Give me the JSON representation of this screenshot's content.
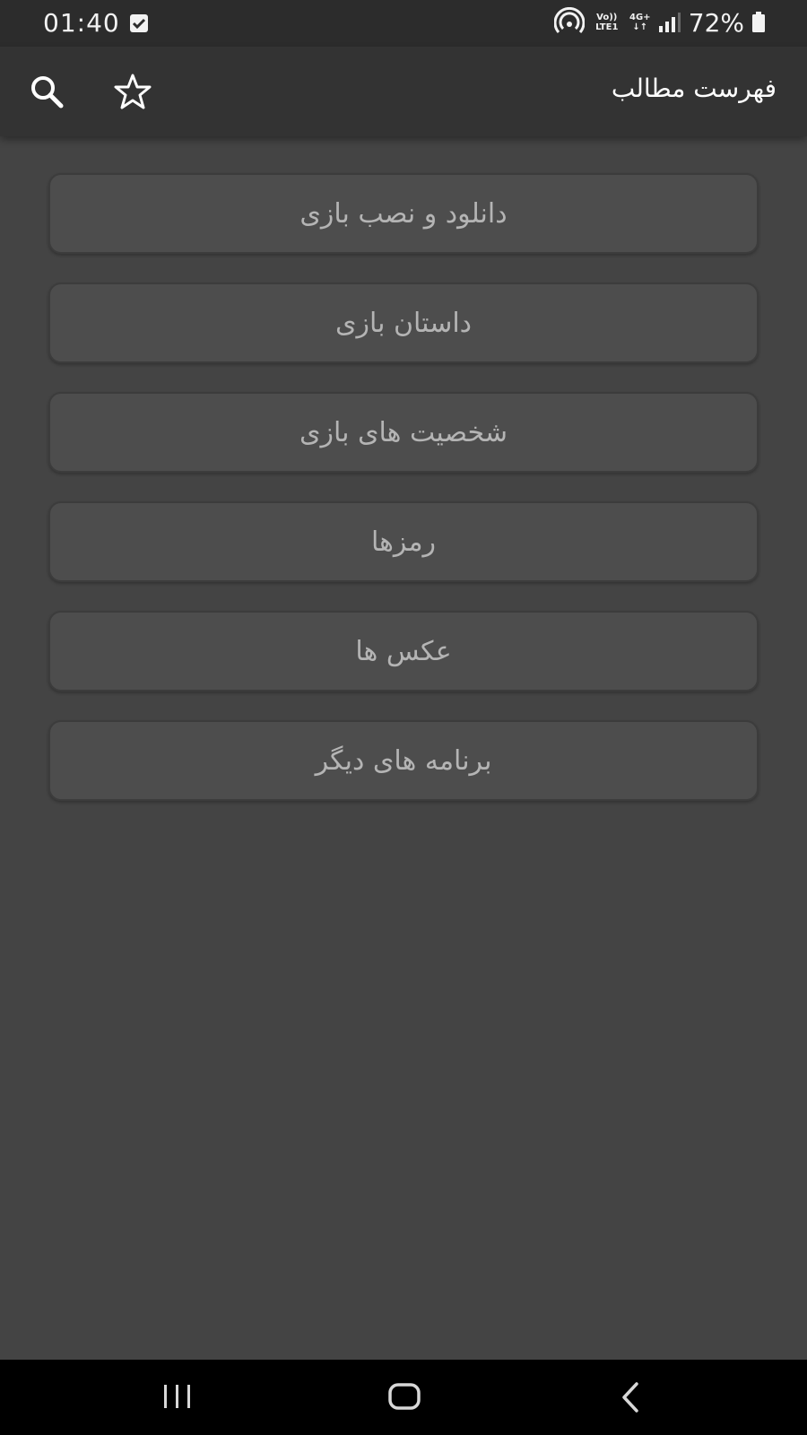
{
  "status_bar": {
    "time": "01:40",
    "volte_top": "Vo))",
    "volte_bottom": "LTE1",
    "network_top": "4G+",
    "network_bottom": "↓↑",
    "battery": "72%",
    "icons": [
      "check-notification-icon",
      "hotspot-icon",
      "signal-icon",
      "battery-icon"
    ]
  },
  "app_bar": {
    "title": "فهرست مطالب",
    "icons": [
      "search-icon",
      "star-icon"
    ]
  },
  "menu": {
    "items": [
      {
        "label": "دانلود و نصب بازی"
      },
      {
        "label": "داستان بازی"
      },
      {
        "label": "شخصیت های بازی"
      },
      {
        "label": "رمزها"
      },
      {
        "label": "عکس ها"
      },
      {
        "label": "برنامه های دیگر"
      }
    ]
  },
  "nav_bar": {
    "icons": [
      "recents-icon",
      "home-icon",
      "back-icon"
    ]
  },
  "colors": {
    "background": "#444444",
    "app_bar": "#333333",
    "status_bar": "#2c2c2c",
    "menu_item": "#4d4d4d",
    "menu_text": "#b4b4b4",
    "nav_bar": "#000000"
  }
}
